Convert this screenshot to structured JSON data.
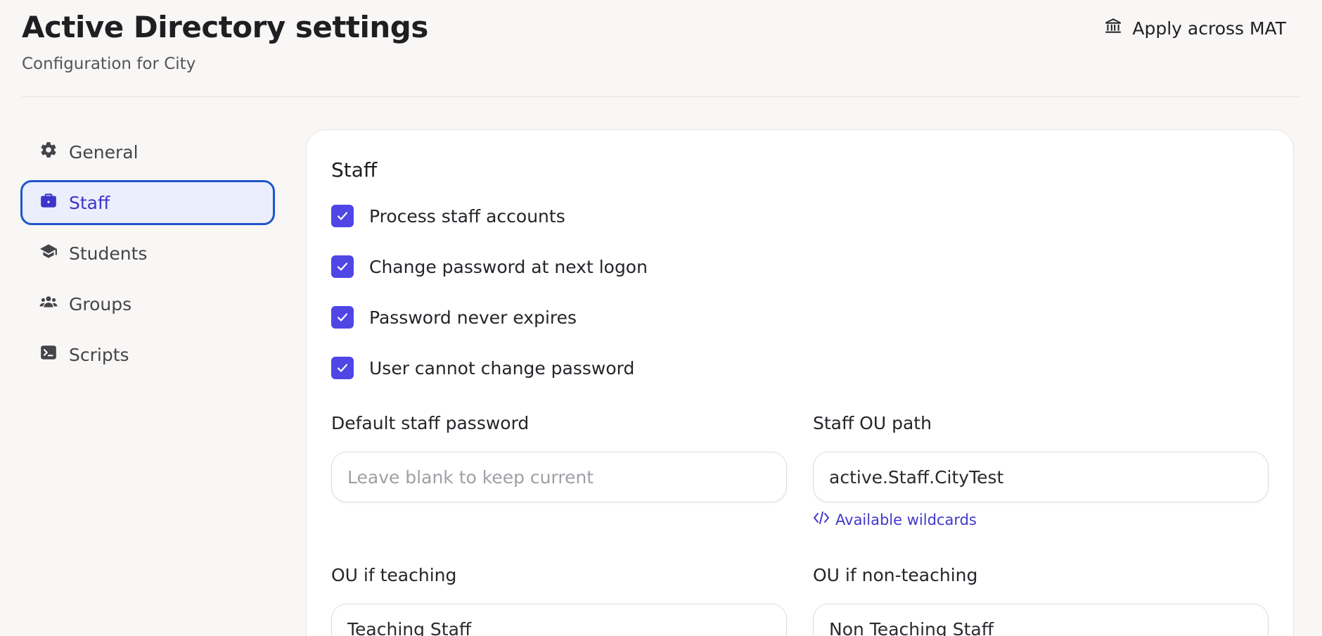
{
  "header": {
    "title": "Active Directory settings",
    "subtitle": "Configuration for City",
    "apply_label": "Apply across MAT"
  },
  "sidebar": {
    "items": [
      {
        "label": "General",
        "icon": "gear-icon"
      },
      {
        "label": "Staff",
        "icon": "briefcase-icon",
        "active": true
      },
      {
        "label": "Students",
        "icon": "graduation-cap-icon"
      },
      {
        "label": "Groups",
        "icon": "users-icon"
      },
      {
        "label": "Scripts",
        "icon": "terminal-icon"
      }
    ]
  },
  "main": {
    "section_title": "Staff",
    "checkboxes": [
      {
        "label": "Process staff accounts",
        "checked": true
      },
      {
        "label": "Change password at next logon",
        "checked": true
      },
      {
        "label": "Password never expires",
        "checked": true
      },
      {
        "label": "User cannot change password",
        "checked": true
      }
    ],
    "fields": {
      "default_password": {
        "label": "Default staff password",
        "value": "",
        "placeholder": "Leave blank to keep current"
      },
      "ou_path": {
        "label": "Staff OU path",
        "value": "active.Staff.CityTest"
      },
      "wildcards_link": "Available wildcards",
      "ou_teaching": {
        "label": "OU if teaching",
        "value": "Teaching Staff"
      },
      "ou_non_teaching": {
        "label": "OU if non-teaching",
        "value": "Non Teaching Staff"
      }
    }
  },
  "colors": {
    "accent": "#4f46e5",
    "active_nav_border": "#1f56c9",
    "active_nav_bg": "#ebeefd",
    "link": "#4338ca",
    "page_bg": "#f8f7f5"
  }
}
